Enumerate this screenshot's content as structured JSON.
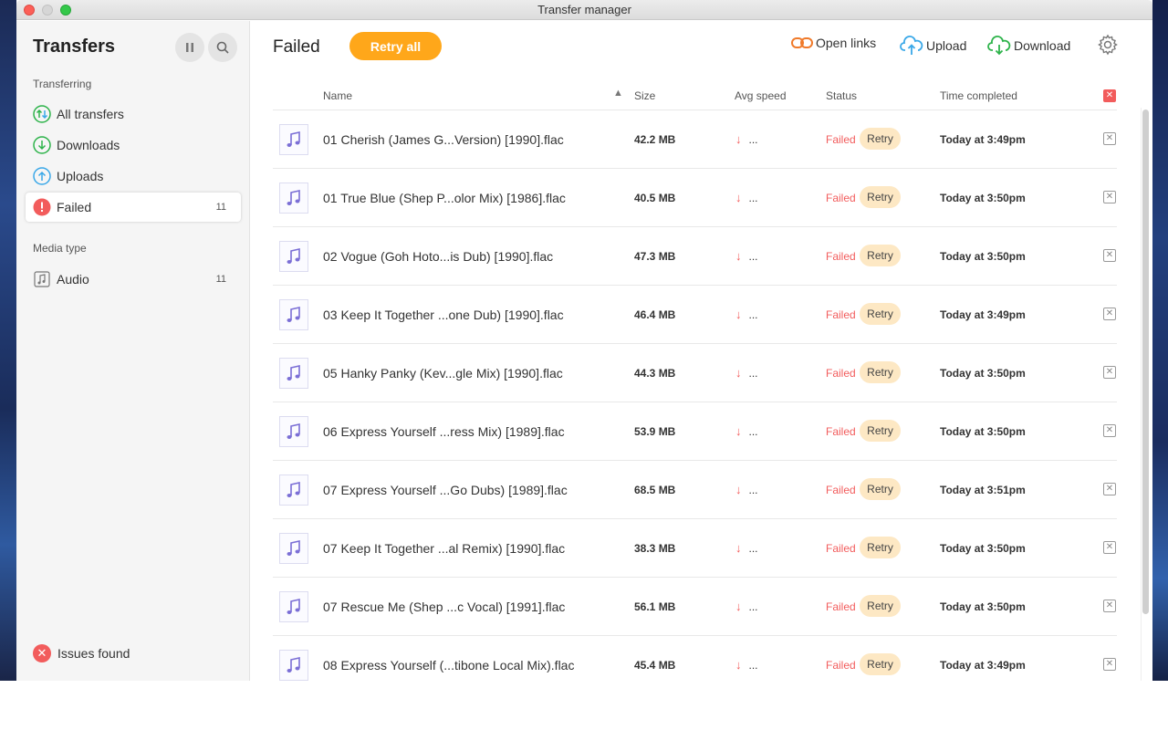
{
  "window": {
    "title": "Transfer manager"
  },
  "sidebar": {
    "title": "Transfers",
    "section_transferring": "Transferring",
    "items": [
      {
        "label": "All transfers",
        "icon": "all-transfers-icon"
      },
      {
        "label": "Downloads",
        "icon": "download-icon"
      },
      {
        "label": "Uploads",
        "icon": "upload-icon"
      },
      {
        "label": "Failed",
        "icon": "failed-icon",
        "count": "11"
      }
    ],
    "section_media": "Media type",
    "media_items": [
      {
        "label": "Audio",
        "count": "11",
        "icon": "audio-icon"
      }
    ],
    "issues_label": "Issues found"
  },
  "header": {
    "title": "Failed",
    "retry_all": "Retry all",
    "open_links": "Open links",
    "upload": "Upload",
    "download": "Download"
  },
  "table": {
    "columns": {
      "name": "Name",
      "size": "Size",
      "avg_speed": "Avg speed",
      "status": "Status",
      "time": "Time completed"
    },
    "rows": [
      {
        "name": "01 Cherish  (James G...Version) [1990].flac",
        "size": "42.2  MB",
        "speed": "...",
        "status": "Failed",
        "retry": "Retry",
        "time": "Today at 3:49pm"
      },
      {
        "name": "01 True Blue  (Shep P...olor Mix) [1986].flac",
        "size": "40.5  MB",
        "speed": "...",
        "status": "Failed",
        "retry": "Retry",
        "time": "Today at 3:50pm"
      },
      {
        "name": "02 Vogue  (Goh Hoto...is Dub) [1990].flac",
        "size": "47.3  MB",
        "speed": "...",
        "status": "Failed",
        "retry": "Retry",
        "time": "Today at 3:50pm"
      },
      {
        "name": "03 Keep It Together ...one Dub) [1990].flac",
        "size": "46.4  MB",
        "speed": "...",
        "status": "Failed",
        "retry": "Retry",
        "time": "Today at 3:49pm"
      },
      {
        "name": "05 Hanky Panky  (Kev...gle Mix) [1990].flac",
        "size": "44.3  MB",
        "speed": "...",
        "status": "Failed",
        "retry": "Retry",
        "time": "Today at 3:50pm"
      },
      {
        "name": "06 Express Yourself  ...ress Mix) [1989].flac",
        "size": "53.9  MB",
        "speed": "...",
        "status": "Failed",
        "retry": "Retry",
        "time": "Today at 3:50pm"
      },
      {
        "name": "07 Express Yourself ...Go Dubs) [1989].flac",
        "size": "68.5  MB",
        "speed": "...",
        "status": "Failed",
        "retry": "Retry",
        "time": "Today at 3:51pm"
      },
      {
        "name": "07 Keep It Together  ...al Remix) [1990].flac",
        "size": "38.3  MB",
        "speed": "...",
        "status": "Failed",
        "retry": "Retry",
        "time": "Today at 3:50pm"
      },
      {
        "name": "07 Rescue Me  (Shep ...c Vocal) [1991].flac",
        "size": "56.1  MB",
        "speed": "...",
        "status": "Failed",
        "retry": "Retry",
        "time": "Today at 3:50pm"
      },
      {
        "name": "08 Express Yourself  (...tibone Local Mix).flac",
        "size": "45.4  MB",
        "speed": "...",
        "status": "Failed",
        "retry": "Retry",
        "time": "Today at 3:49pm"
      }
    ]
  },
  "colors": {
    "accent": "#ffa71a",
    "error": "#f25c5c",
    "retry_bg": "#fde8c4",
    "download": "#2db34a",
    "upload": "#3aa8e8",
    "links": "#f07a2a"
  }
}
